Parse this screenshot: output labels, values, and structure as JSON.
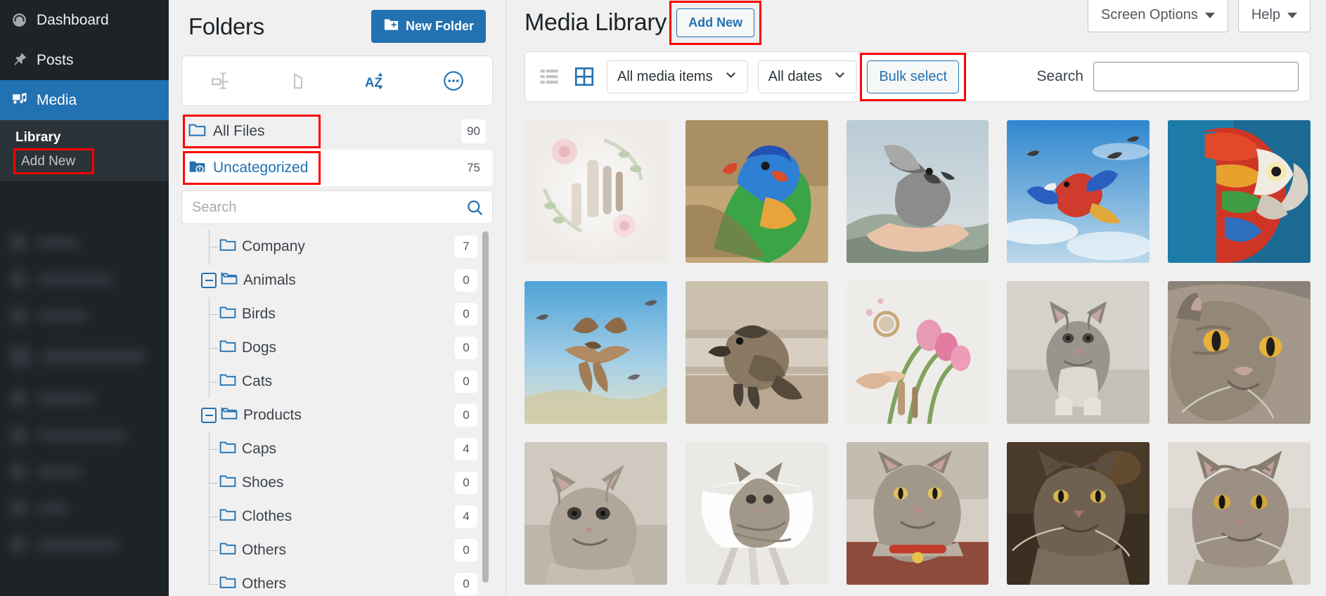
{
  "admin_sidebar": {
    "items": [
      {
        "label": "Dashboard",
        "icon": "dashboard-icon",
        "current": false
      },
      {
        "label": "Posts",
        "icon": "pin-icon",
        "current": false
      },
      {
        "label": "Media",
        "icon": "media-icon",
        "current": true
      }
    ],
    "submenu": [
      {
        "label": "Library",
        "current": true,
        "highlighted": false
      },
      {
        "label": "Add New",
        "current": false,
        "highlighted": true
      }
    ]
  },
  "top_right": {
    "screen_options_label": "Screen Options",
    "help_label": "Help"
  },
  "folders_panel": {
    "title": "Folders",
    "new_folder_label": "New Folder",
    "toolbar_icons": [
      {
        "name": "collapse-tree-icon"
      },
      {
        "name": "duplicate-folder-icon"
      },
      {
        "name": "sort-az-icon"
      },
      {
        "name": "more-options-icon"
      }
    ],
    "search": {
      "placeholder": "Search",
      "value": ""
    },
    "quick_items": [
      {
        "label": "All Files",
        "count": "90",
        "icon": "folder-outline-icon",
        "highlighted": true,
        "selected": false
      },
      {
        "label": "Uncategorized",
        "count": "75",
        "icon": "folder-warning-icon",
        "highlighted": true,
        "selected": true
      }
    ],
    "tree": [
      {
        "label": "Company",
        "count": "7",
        "depth": 1,
        "toggle": "none",
        "icon": "folder-outline-icon"
      },
      {
        "label": "Animals",
        "count": "0",
        "depth": 0,
        "toggle": "expanded",
        "icon": "folder-open-icon"
      },
      {
        "label": "Birds",
        "count": "0",
        "depth": 1,
        "toggle": "none",
        "icon": "folder-outline-icon"
      },
      {
        "label": "Dogs",
        "count": "0",
        "depth": 1,
        "toggle": "none",
        "icon": "folder-outline-icon"
      },
      {
        "label": "Cats",
        "count": "0",
        "depth": 1,
        "toggle": "none",
        "icon": "folder-outline-icon"
      },
      {
        "label": "Products",
        "count": "0",
        "depth": 0,
        "toggle": "expanded",
        "icon": "folder-open-icon"
      },
      {
        "label": "Caps",
        "count": "4",
        "depth": 1,
        "toggle": "none",
        "icon": "folder-outline-icon"
      },
      {
        "label": "Shoes",
        "count": "0",
        "depth": 1,
        "toggle": "none",
        "icon": "folder-outline-icon"
      },
      {
        "label": "Clothes",
        "count": "4",
        "depth": 1,
        "toggle": "none",
        "icon": "folder-outline-icon"
      },
      {
        "label": "Others",
        "count": "0",
        "depth": 1,
        "toggle": "none",
        "icon": "folder-outline-icon"
      },
      {
        "label": "Others",
        "count": "0",
        "depth": 0,
        "toggle": "none",
        "icon": "folder-outline-icon"
      }
    ]
  },
  "media": {
    "title": "Media Library",
    "add_new_label": "Add New",
    "view_list_icon": "list-view-icon",
    "view_grid_icon": "grid-view-icon",
    "filter_media_type": "All media items",
    "filter_dates": "All dates",
    "bulk_select_label": "Bulk select",
    "search_label": "Search",
    "search_value": "",
    "search_placeholder": "",
    "items": [
      {
        "alt": "cosmetics-flatlay-thumbnail"
      },
      {
        "alt": "rainbow-lorikeet-thumbnail"
      },
      {
        "alt": "bird-on-hand-thumbnail"
      },
      {
        "alt": "macaw-flying-thumbnail"
      },
      {
        "alt": "scarlet-macaw-closeup-thumbnail"
      },
      {
        "alt": "seagull-flying-thumbnail"
      },
      {
        "alt": "sparrow-on-wood-thumbnail"
      },
      {
        "alt": "tulips-and-makeup-thumbnail"
      },
      {
        "alt": "grey-tabby-sitting-thumbnail"
      },
      {
        "alt": "tabby-cat-closeup-thumbnail"
      },
      {
        "alt": "fluffy-kitten-thumbnail"
      },
      {
        "alt": "kitten-on-chair-thumbnail"
      },
      {
        "alt": "cat-with-collar-thumbnail"
      },
      {
        "alt": "tabby-cat-dark-thumbnail"
      },
      {
        "alt": "tabby-cat-looking-up-thumbnail"
      }
    ]
  },
  "colors": {
    "wp_blue": "#2271b1",
    "sidebar_bg": "#1d2327",
    "highlight_red": "#ff0000",
    "page_bg": "#f0f0f1"
  }
}
